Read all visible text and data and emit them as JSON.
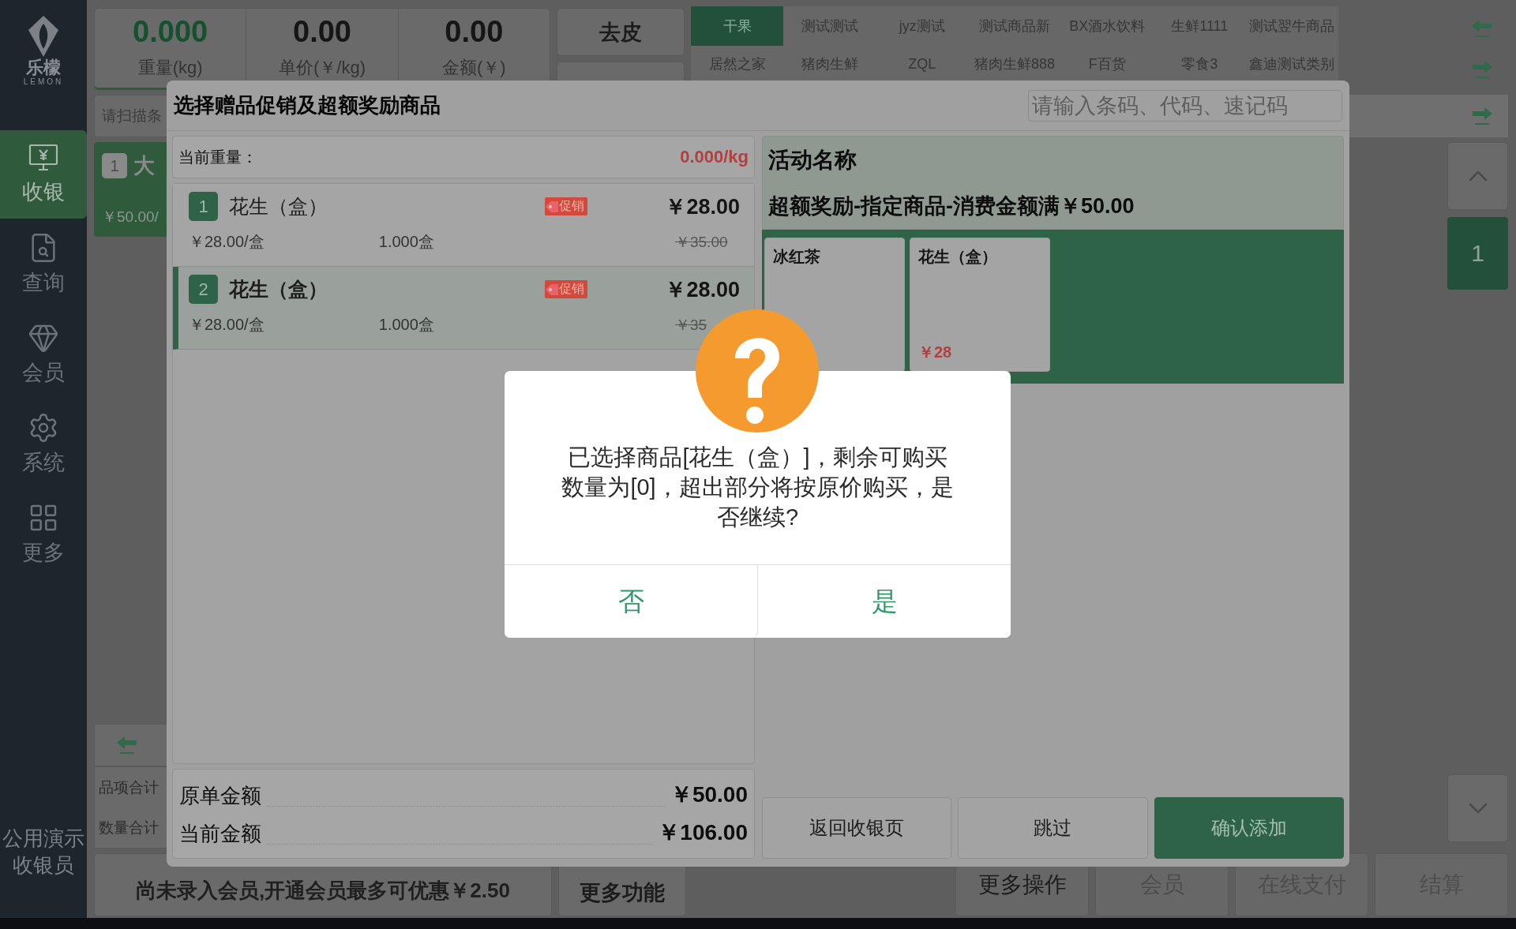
{
  "sidebar": {
    "logo": {
      "title": "乐檬",
      "subtitle": "LEMON"
    },
    "items": [
      {
        "label": "收银",
        "selected": true
      },
      {
        "label": "查询",
        "selected": false
      },
      {
        "label": "会员",
        "selected": false
      },
      {
        "label": "系统",
        "selected": false
      },
      {
        "label": "更多",
        "selected": false
      }
    ],
    "user": {
      "name": "公用演示",
      "role": "收银员"
    }
  },
  "scale": {
    "metrics": [
      {
        "value": "0.000",
        "label": "重量(kg)",
        "kind": "weight"
      },
      {
        "value": "0.00",
        "label": "单价(￥/kg)",
        "kind": "plain"
      },
      {
        "value": "0.00",
        "label": "金额(￥)",
        "kind": "plain"
      }
    ],
    "button": "去皮"
  },
  "categories": [
    {
      "label": "干果",
      "selected": true
    },
    {
      "label": "测试测试",
      "selected": false
    },
    {
      "label": "jyz测试",
      "selected": false
    },
    {
      "label": "测试商品新",
      "selected": false
    },
    {
      "label": "BX酒水饮料",
      "selected": false
    },
    {
      "label": "生鲜1111",
      "selected": false
    },
    {
      "label": "测试翌牛商品",
      "selected": false
    },
    {
      "label": "居然之家",
      "selected": false
    },
    {
      "label": "猪肉生鲜",
      "selected": false
    },
    {
      "label": "ZQL",
      "selected": false
    },
    {
      "label": "猪肉生鲜888",
      "selected": false
    },
    {
      "label": "F百货",
      "selected": false
    },
    {
      "label": "零食3",
      "selected": false
    },
    {
      "label": "鑫迪测试类别",
      "selected": false
    }
  ],
  "search": {
    "placeholder": "请扫描条"
  },
  "cart": {
    "items": [
      {
        "index": "1",
        "name": "大",
        "price": "￥50.00/"
      }
    ],
    "totals": [
      "品项合计",
      "数量合计"
    ]
  },
  "pager": {
    "page": "1"
  },
  "member_banner": "尚未录入会员,开通会员最多可优惠￥2.50",
  "more_functions": "更多功能",
  "actions": [
    {
      "label": "更多操作",
      "disabled": false
    },
    {
      "label": "会员",
      "disabled": true
    },
    {
      "label": "在线支付",
      "disabled": true
    },
    {
      "label": "结算",
      "disabled": true
    }
  ],
  "modal": {
    "title": "选择赠品促销及超额奖励商品",
    "search": {
      "placeholder": "请输入条码、代码、速记码"
    },
    "weight": {
      "label": "当前重量：",
      "value": "0.000/kg"
    },
    "items": [
      {
        "index": "1",
        "name": "花生（盒）",
        "promo": "促销",
        "price": "￥28.00",
        "unit_price": "￥28.00/盒",
        "quantity": "1.000盒",
        "original_price": "￥35.00",
        "selected": false
      },
      {
        "index": "2",
        "name": "花生（盒）",
        "promo": "促销",
        "price": "￥28.00",
        "unit_price": "￥28.00/盒",
        "quantity": "1.000盒",
        "original_price": "￥35",
        "selected": true
      }
    ],
    "totals": [
      {
        "label": "原单金额",
        "value": "￥50.00"
      },
      {
        "label": "当前金额",
        "value": "￥106.00"
      }
    ],
    "activity": {
      "header": "活动名称",
      "name": "超额奖励-指定商品-消费金额满￥50.00",
      "products": [
        {
          "name": "冰红茶"
        },
        {
          "name": "花生（盒）",
          "price": "￥28"
        }
      ]
    },
    "buttons": [
      {
        "label": "返回收银页",
        "kind": "plain"
      },
      {
        "label": "跳过",
        "kind": "plain"
      },
      {
        "label": "确认添加",
        "kind": "primary"
      }
    ]
  },
  "confirm": {
    "message": "已选择商品[花生（盒）]，剩余可购买数量为[0]，超出部分将按原价购买，是否继续?",
    "buttons": [
      {
        "label": "否"
      },
      {
        "label": "是"
      }
    ]
  }
}
